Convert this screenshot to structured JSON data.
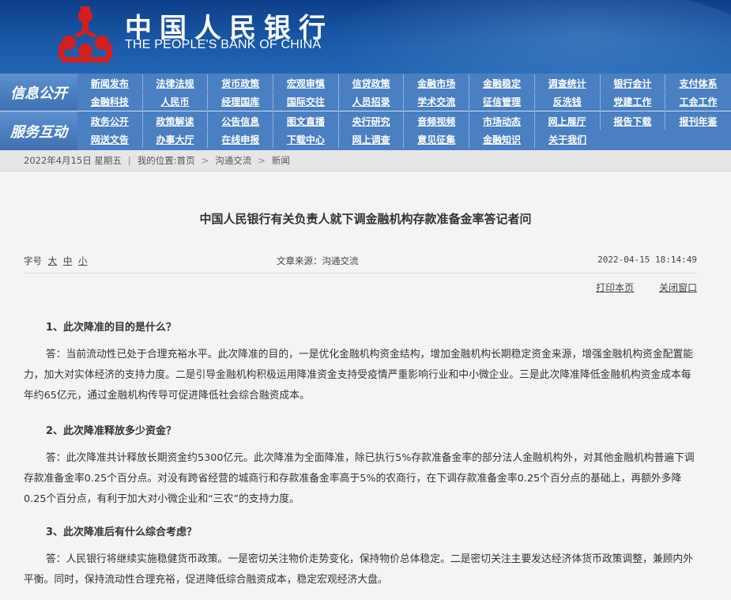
{
  "header": {
    "logo_cn": "中国人民银行",
    "logo_en": "THE PEOPLE'S BANK OF CHINA",
    "brand_color": "#0d3f8a",
    "logo_color": "#d41f1f"
  },
  "nav": {
    "info_label": "信息公开",
    "info_row1": [
      "新闻发布",
      "法律法规",
      "货币政策",
      "宏观审慎",
      "信贷政策",
      "金融市场",
      "金融稳定",
      "调查统计",
      "银行会计",
      "支付体系"
    ],
    "info_row2": [
      "金融科技",
      "人民币",
      "经理国库",
      "国际交往",
      "人员招录",
      "学术交流",
      "征信管理",
      "反洗钱",
      "党建工作",
      "工会工作"
    ],
    "service_label": "服务互动",
    "service_row1": [
      "政务公开",
      "政策解读",
      "公告信息",
      "图文直播",
      "央行研究",
      "音频视频",
      "市场动态",
      "网上展厅",
      "报告下载",
      "报刊年鉴"
    ],
    "service_row2": [
      "网送文告",
      "办事大厅",
      "在线申报",
      "下载中心",
      "网上调查",
      "意见征集",
      "金融知识",
      "关于我们"
    ]
  },
  "breadcrumb": {
    "date": "2022年4月15日  星期五",
    "location_label": "我的位置:",
    "items": [
      "首页",
      "沟通交流",
      "新闻"
    ]
  },
  "article": {
    "title": "中国人民银行有关负责人就下调金融机构存款准备金率答记者问",
    "font_size_label": "字号",
    "font_large": "大",
    "font_medium": "中",
    "font_small": "小",
    "source": "文章来源：沟通交流",
    "time": "2022-04-15 18:14:49",
    "print_label": "打印本页",
    "close_label": "关闭窗口",
    "q1": "1、此次降准的目的是什么？",
    "a1": "答：当前流动性已处于合理充裕水平。此次降准的目的，一是优化金融机构资金结构，增加金融机构长期稳定资金来源，增强金融机构资金配置能力，加大对实体经济的支持力度。二是引导金融机构积极运用降准资金支持受疫情严重影响行业和中小微企业。三是此次降准降低金融机构资金成本每年约65亿元，通过金融机构传导可促进降低社会综合融资成本。",
    "q2": "2、此次降准释放多少资金？",
    "a2": "答：此次降准共计释放长期资金约5300亿元。此次降准为全面降准，除已执行5%存款准备金率的部分法人金融机构外，对其他金融机构普遍下调存款准备金率0.25个百分点。对没有跨省经营的城商行和存款准备金率高于5%的农商行，在下调存款准备金率0.25个百分点的基础上，再额外多降0.25个百分点，有利于加大对小微企业和“三农”的支持力度。",
    "q3": "3、此次降准后有什么综合考虑？",
    "a3": "答：人民银行将继续实施稳健货币政策。一是密切关注物价走势变化，保持物价总体稳定。二是密切关注主要发达经济体货币政策调整，兼顾内外平衡。同时，保持流动性合理充裕，促进降低综合融资成本，稳定宏观经济大盘。"
  }
}
